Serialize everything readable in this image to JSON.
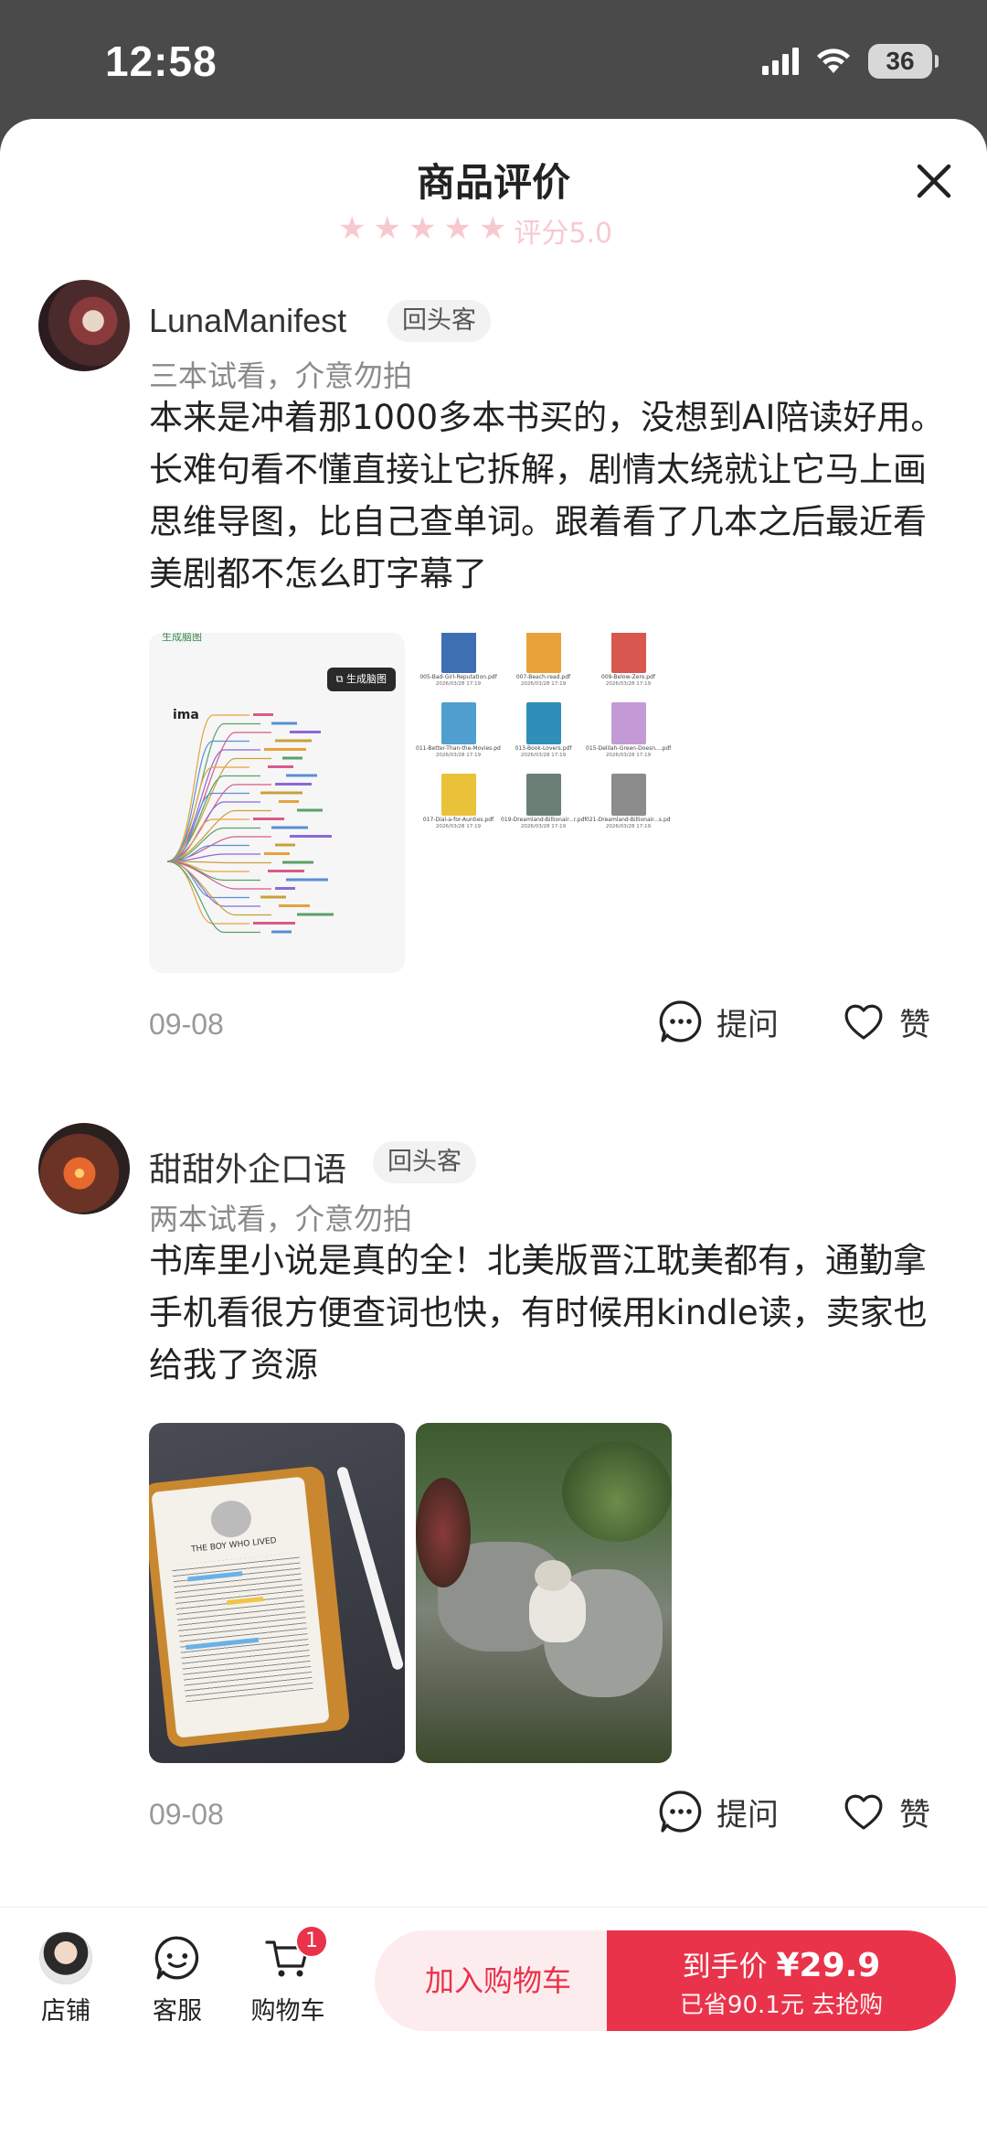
{
  "status": {
    "time": "12:58",
    "battery": "36"
  },
  "sheet": {
    "title": "商品评价",
    "rating_peek": "评分5.0"
  },
  "reviews": [
    {
      "user": "LunaManifest",
      "badge": "回头客",
      "variant": "三本试看，介意勿拍",
      "content": "本来是冲着那1000多本书买的，没想到AI陪读好用。长难句看不懂直接让它拆解，剧情太绕就让它马上画思维导图，比自己查单词。跟着看了几本之后最近看美剧都不怎么盯字幕了",
      "images": [
        {
          "header": "生成脑图",
          "brand": "ima"
        },
        {
          "files": [
            {
              "name": "005-Bad-Girl-Reputation.pdf",
              "date": "2026/03/28 17:19"
            },
            {
              "name": "007-Beach-read.pdf",
              "date": "2026/03/28 17:19"
            },
            {
              "name": "009-Below-Zero.pdf",
              "date": "2026/03/28 17:19"
            },
            {
              "name": "011-Better-Than-the-Movies.pdf",
              "date": "2026/03/28 17:19"
            },
            {
              "name": "013-Book-Lovers.pdf",
              "date": "2026/03/28 17:19"
            },
            {
              "name": "015-Delilah-Green-Doesn....pdf",
              "date": "2026/03/28 17:19"
            },
            {
              "name": "017-Dial-a-for-Aunties.pdf",
              "date": "2026/03/28 17:19"
            },
            {
              "name": "019-Dreamland-Billionair...r.pdf",
              "date": "2026/03/28 17:19"
            },
            {
              "name": "021-Dreamland-Billionair...s.pdf",
              "date": "2026/03/28 17:19"
            }
          ]
        }
      ],
      "date": "09-08",
      "ask_label": "提问",
      "like_label": "赞"
    },
    {
      "user": "甜甜外企口语",
      "badge": "回头客",
      "variant": "两本试看，介意勿拍",
      "content": "书库里小说是真的全！北美版晋江耽美都有，通勤拿手机看很方便查词也快，有时候用kindle读，卖家也给我了资源",
      "images": [
        {
          "book_title": "THE BOY WHO LIVED"
        },
        {}
      ],
      "date": "09-08",
      "ask_label": "提问",
      "like_label": "赞"
    }
  ],
  "bottom_bar": {
    "store_label": "店铺",
    "service_label": "客服",
    "cart_label": "购物车",
    "cart_count": "1",
    "add_to_cart": "加入购物车",
    "buy_prefix": "到手价 ",
    "price": "¥29.9",
    "savings": "已省90.1元 去抢购"
  },
  "colors": {
    "accent": "#e9334a",
    "accent_light": "#fdecee"
  }
}
